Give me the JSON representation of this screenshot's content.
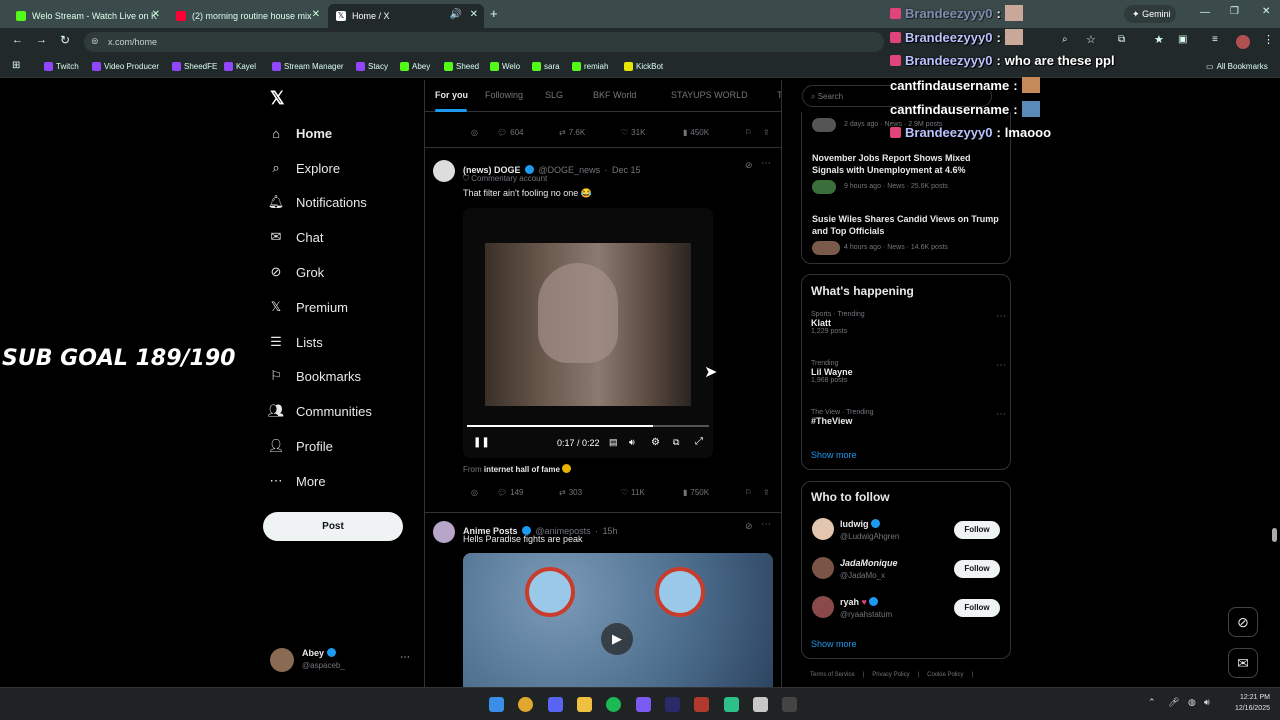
{
  "browser": {
    "tabs": [
      {
        "title": "Welo Stream - Watch Live on K"
      },
      {
        "title": "(2) morning routine house mix"
      },
      {
        "title": "Home / X"
      }
    ],
    "new_tab": "+",
    "gemini_label": "Gemini",
    "url": "x.com/home",
    "bookmarks": [
      "Twitch",
      "Video Producer",
      "SheedFE",
      "Kayel",
      "Stream Manager",
      "Stacy",
      "Abey",
      "Sheed",
      "Welo",
      "sara",
      "remiah",
      "KickBot"
    ],
    "all_bookmarks": "All Bookmarks"
  },
  "sidebar": {
    "items": [
      {
        "label": "Home",
        "icon": "home-icon"
      },
      {
        "label": "Explore",
        "icon": "search-icon"
      },
      {
        "label": "Notifications",
        "icon": "bell-icon"
      },
      {
        "label": "Chat",
        "icon": "mail-icon"
      },
      {
        "label": "Grok",
        "icon": "grok-icon"
      },
      {
        "label": "Premium",
        "icon": "x-icon"
      },
      {
        "label": "Lists",
        "icon": "list-icon"
      },
      {
        "label": "Bookmarks",
        "icon": "bookmark-icon"
      },
      {
        "label": "Communities",
        "icon": "people-icon"
      },
      {
        "label": "Profile",
        "icon": "person-icon"
      },
      {
        "label": "More",
        "icon": "more-icon"
      }
    ],
    "post_label": "Post",
    "account": {
      "name": "Abey",
      "handle": "@aspaceb_"
    }
  },
  "feed": {
    "tabs": [
      "For you",
      "Following",
      "SLG",
      "BKF World",
      "STAYUPS WORLD",
      "Ti"
    ],
    "top_stats": {
      "replies": "604",
      "reposts": "7.6K",
      "likes": "31K",
      "views": "450K"
    },
    "tweets": [
      {
        "name": "(news) DOGE",
        "handle": "@DOGE_news",
        "date": "Dec 15",
        "sublabel": "Commentary account",
        "text": "That filter ain't fooling no one 😂",
        "video_time": "0:17 / 0:22",
        "video_progress": 0.77,
        "from_label": "From",
        "from_source": "internet hall of fame",
        "stats": {
          "replies": "149",
          "reposts": "303",
          "likes": "11K",
          "views": "750K"
        }
      },
      {
        "name": "Anime Posts",
        "handle": "@animeposts",
        "date": "15h",
        "text": "Hells Paradise fights are peak"
      }
    ]
  },
  "right": {
    "search_placeholder": "Search",
    "news": [
      {
        "meta": "2 days ago · News · 2.9M posts"
      },
      {
        "title": "November Jobs Report Shows Mixed Signals with Unemployment at 4.6%",
        "meta": "9 hours ago · News · 25.6K posts"
      },
      {
        "title": "Susie Wiles Shares Candid Views on Trump and Top Officials",
        "meta": "4 hours ago · News · 14.6K posts"
      }
    ],
    "happening_title": "What's happening",
    "trends": [
      {
        "category": "Sports · Trending",
        "name": "Klatt",
        "count": "1,229 posts"
      },
      {
        "category": "Trending",
        "name": "Lil Wayne",
        "count": "1,968 posts"
      },
      {
        "category": "The View · Trending",
        "name": "#TheView",
        "count": ""
      }
    ],
    "show_more": "Show more",
    "who_to_follow_title": "Who to follow",
    "follow": [
      {
        "name": "ludwig",
        "handle": "@LudwigAhgren"
      },
      {
        "name": "JadaMonique",
        "handle": "@JadaMo_x"
      },
      {
        "name": "ryah",
        "handle": "@ryaahstatum"
      }
    ],
    "follow_label": "Follow",
    "footer": [
      "Terms of Service",
      "Privacy Policy",
      "Cookie Policy"
    ]
  },
  "overlay": {
    "subgoal": "SUB GOAL 189/190",
    "chat": [
      {
        "user": "Brandeezyyy0",
        "msg": ""
      },
      {
        "user": "Brandeezyyy0",
        "msg": ""
      },
      {
        "user": "Brandeezyyy0",
        "msg": "who are these ppl"
      },
      {
        "user": "cantfindausername",
        "msg": ""
      },
      {
        "user": "cantfindausername",
        "msg": ""
      },
      {
        "user": "Brandeezyyy0",
        "msg": "lmaooo"
      }
    ]
  },
  "taskbar": {
    "time": "12:21 PM",
    "date": "12/16/2025"
  }
}
